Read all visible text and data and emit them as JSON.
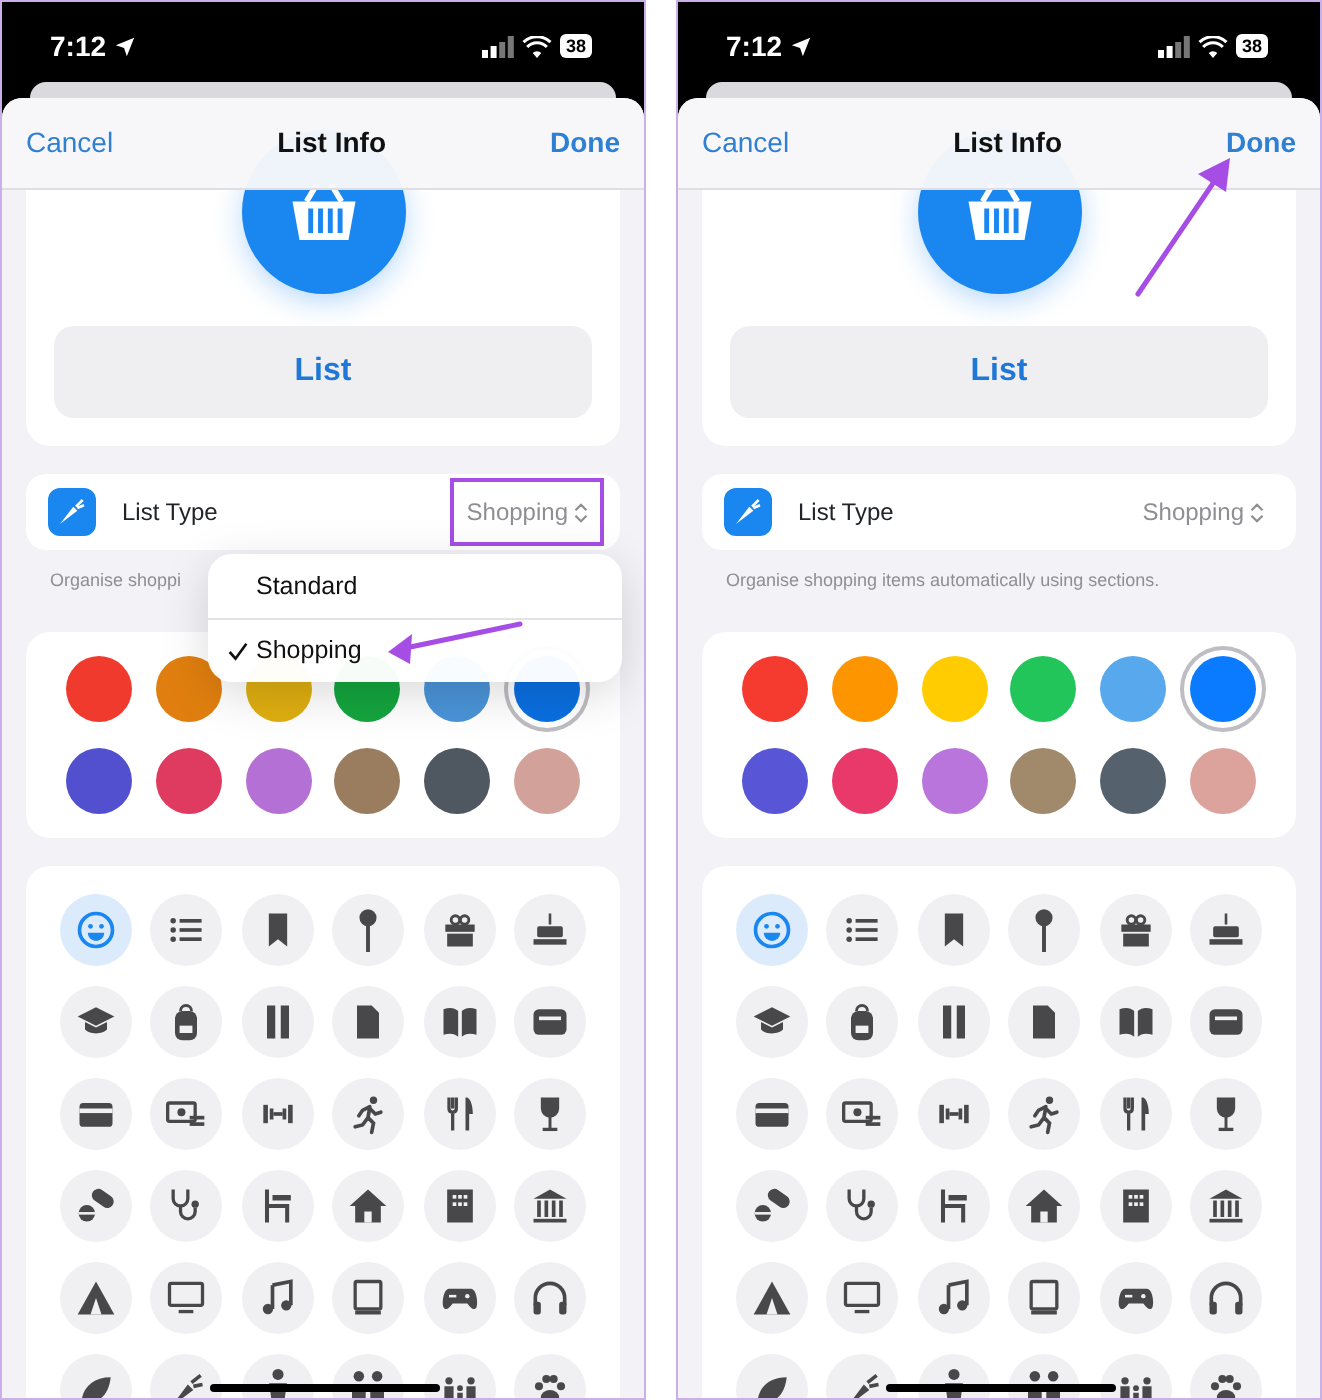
{
  "screens": [
    {
      "status_bar": {
        "time": "7:12",
        "battery": "38"
      },
      "nav": {
        "cancel": "Cancel",
        "title": "List Info",
        "done": "Done"
      },
      "list_name": "List",
      "list_type": {
        "label": "List Type",
        "value": "Shopping",
        "highlighted": true
      },
      "footer": "Organise shoppi",
      "menu": {
        "items": [
          {
            "label": "Standard",
            "selected": false
          },
          {
            "label": "Shopping",
            "selected": true
          }
        ]
      },
      "kind": "menu",
      "colors": [
        {
          "color": "#f03a2e",
          "selected": false
        },
        {
          "color": "#e07f0f",
          "selected": false
        },
        {
          "color": "#dfae10",
          "selected": false
        },
        {
          "color": "#14a53e",
          "selected": false
        },
        {
          "color": "#4a94d8",
          "selected": false
        },
        {
          "color": "#0a6fe0",
          "selected": true
        },
        {
          "color": "#5250cf",
          "selected": false
        },
        {
          "color": "#df3a5f",
          "selected": false
        },
        {
          "color": "#b570d6",
          "selected": false
        },
        {
          "color": "#9a7d5e",
          "selected": false
        },
        {
          "color": "#4f5761",
          "selected": false
        },
        {
          "color": "#d2a29a",
          "selected": false
        }
      ],
      "icons": [
        {
          "selected": true
        },
        {
          "selected": false
        },
        {
          "selected": false
        },
        {
          "selected": false
        },
        {
          "selected": false
        },
        {
          "selected": false
        },
        {
          "selected": false
        },
        {
          "selected": false
        },
        {
          "selected": false
        },
        {
          "selected": false
        },
        {
          "selected": false
        },
        {
          "selected": false
        },
        {
          "selected": false
        },
        {
          "selected": false
        },
        {
          "selected": false
        },
        {
          "selected": false
        },
        {
          "selected": false
        },
        {
          "selected": false
        },
        {
          "selected": false
        },
        {
          "selected": false
        },
        {
          "selected": false
        },
        {
          "selected": false
        },
        {
          "selected": false
        },
        {
          "selected": false
        },
        {
          "selected": false
        },
        {
          "selected": false
        },
        {
          "selected": false
        },
        {
          "selected": false
        },
        {
          "selected": false
        },
        {
          "selected": false
        },
        {
          "selected": false
        },
        {
          "selected": false
        },
        {
          "selected": false
        },
        {
          "selected": false
        },
        {
          "selected": false
        },
        {
          "selected": false
        }
      ]
    },
    {
      "status_bar": {
        "time": "7:12",
        "battery": "38"
      },
      "nav": {
        "cancel": "Cancel",
        "title": "List Info",
        "done": "Done"
      },
      "list_name": "List",
      "list_type": {
        "label": "List Type",
        "value": "Shopping",
        "highlighted": false
      },
      "footer": "Organise shopping items automatically using sections.",
      "kind": "done",
      "colors": [
        {
          "color": "#f53a30",
          "selected": false
        },
        {
          "color": "#fd9500",
          "selected": false
        },
        {
          "color": "#fecc00",
          "selected": false
        },
        {
          "color": "#22c55a",
          "selected": false
        },
        {
          "color": "#57a8ed",
          "selected": false
        },
        {
          "color": "#0a7aff",
          "selected": true
        },
        {
          "color": "#5856d6",
          "selected": false
        },
        {
          "color": "#e9386a",
          "selected": false
        },
        {
          "color": "#ba75dc",
          "selected": false
        },
        {
          "color": "#a18a6c",
          "selected": false
        },
        {
          "color": "#56616e",
          "selected": false
        },
        {
          "color": "#dba39c",
          "selected": false
        }
      ],
      "icons": [
        {
          "selected": true
        },
        {
          "selected": false
        },
        {
          "selected": false
        },
        {
          "selected": false
        },
        {
          "selected": false
        },
        {
          "selected": false
        },
        {
          "selected": false
        },
        {
          "selected": false
        },
        {
          "selected": false
        },
        {
          "selected": false
        },
        {
          "selected": false
        },
        {
          "selected": false
        },
        {
          "selected": false
        },
        {
          "selected": false
        },
        {
          "selected": false
        },
        {
          "selected": false
        },
        {
          "selected": false
        },
        {
          "selected": false
        },
        {
          "selected": false
        },
        {
          "selected": false
        },
        {
          "selected": false
        },
        {
          "selected": false
        },
        {
          "selected": false
        },
        {
          "selected": false
        },
        {
          "selected": false
        },
        {
          "selected": false
        },
        {
          "selected": false
        },
        {
          "selected": false
        },
        {
          "selected": false
        },
        {
          "selected": false
        },
        {
          "selected": false
        },
        {
          "selected": false
        },
        {
          "selected": false
        },
        {
          "selected": false
        },
        {
          "selected": false
        },
        {
          "selected": false
        }
      ]
    }
  ]
}
